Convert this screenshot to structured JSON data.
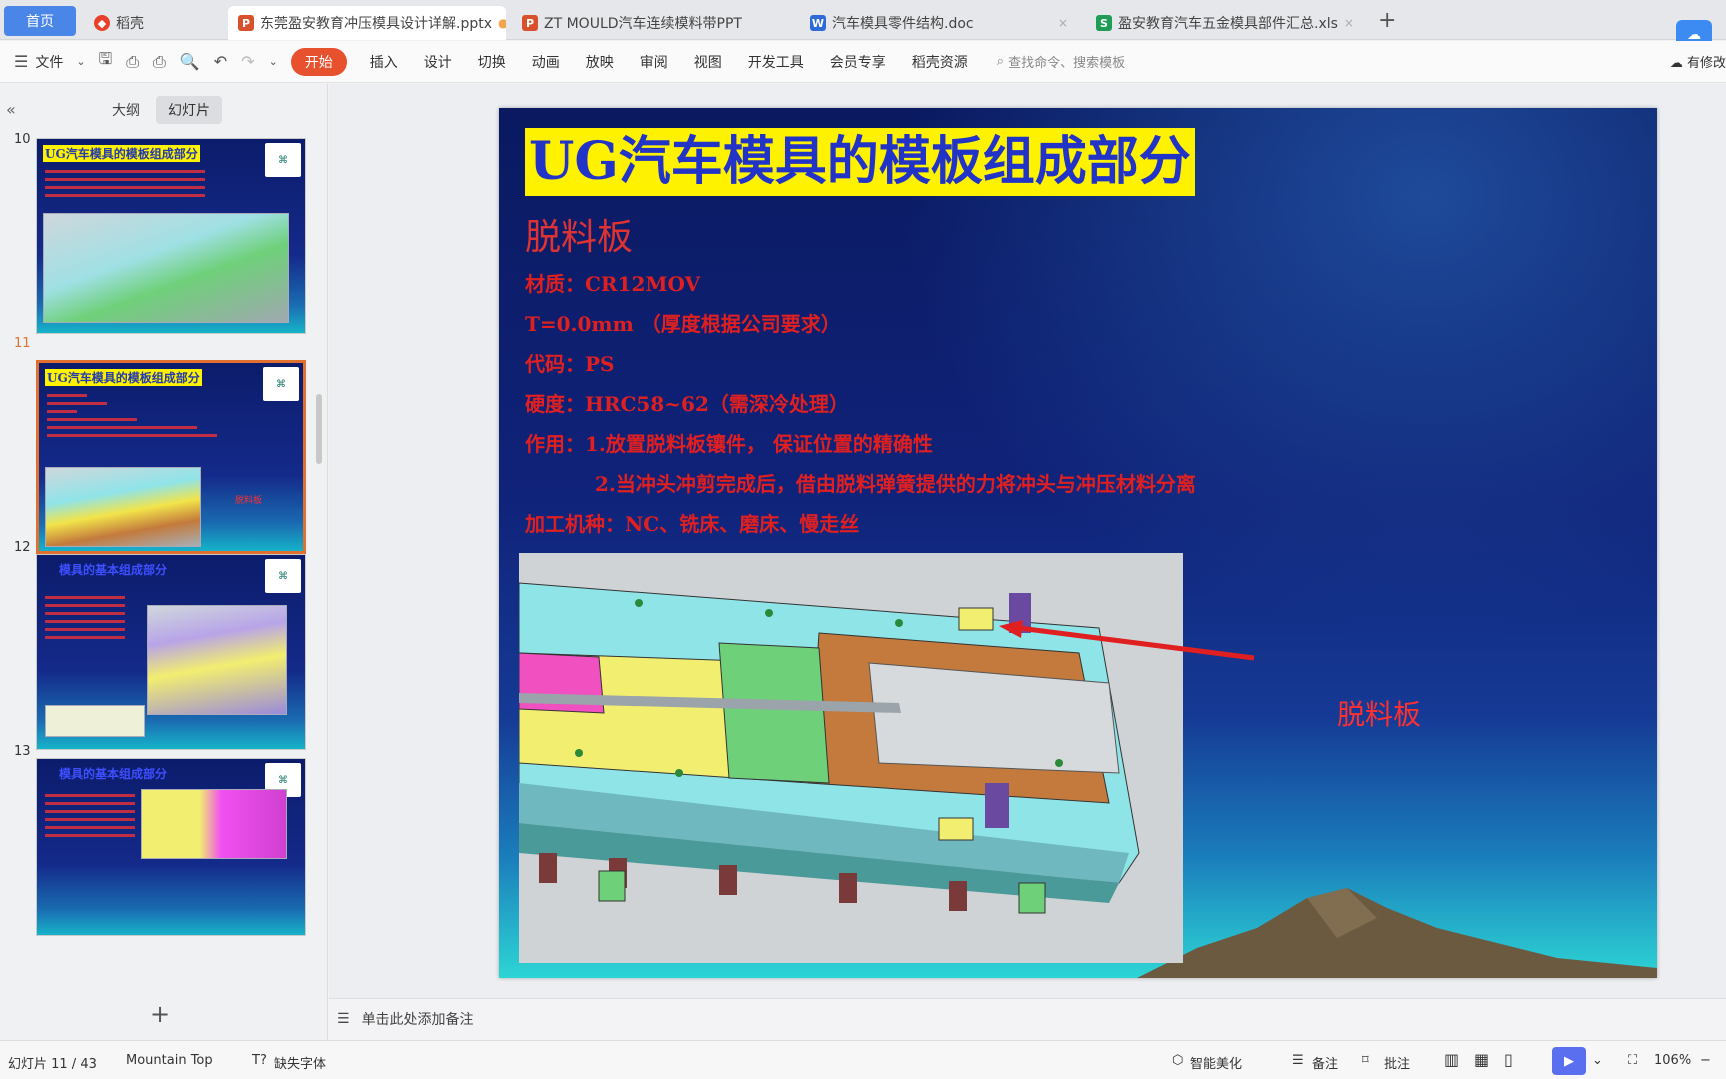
{
  "tabs": [
    {
      "label": "首页",
      "type": "home"
    },
    {
      "label": "稻壳",
      "icon": "docer"
    },
    {
      "label": "东莞盈安教育冲压模具设计详解.pptx",
      "icon": "ppt",
      "active": true
    },
    {
      "label": "ZT MOULD汽车连续模料带PPT",
      "icon": "ppt"
    },
    {
      "label": "汽车模具零件结构.doc",
      "icon": "doc"
    },
    {
      "label": "盈安教育汽车五金模具部件汇总.xls",
      "icon": "xls"
    }
  ],
  "toolbar": {
    "file": "文件",
    "start": "开始",
    "menus": [
      "插入",
      "设计",
      "切换",
      "动画",
      "放映",
      "审阅",
      "视图",
      "开发工具",
      "会员专享",
      "稻壳资源"
    ],
    "search_placeholder": "查找命令、搜索模板",
    "saved": "有修改"
  },
  "leftpane": {
    "outline": "大纲",
    "slides": "幻灯片"
  },
  "thumbs": [
    {
      "num": "10",
      "title": "UG汽车模具的模板组成部分"
    },
    {
      "num": "11",
      "title": "UG汽车模具的模板组成部分",
      "label": "脱料板"
    },
    {
      "num": "12",
      "title": "模具的基本组成部分"
    },
    {
      "num": "13",
      "title": "模具的基本组成部分"
    }
  ],
  "slide": {
    "title": "UG汽车模具的模板组成部分",
    "subtitle": "脱料板",
    "lines": [
      "材质：CR12MOV",
      "T=0.0mm （厚度根据公司要求）",
      "代码：PS",
      "硬度：HRC58~62（需深冷处理）",
      "作用：1.放置脱料板镶件， 保证位置的精确性",
      "2.当冲头冲剪完成后，借由脱料弹簧提供的力将冲头与冲压材料分离",
      "加工机种：NC、铣床、磨床、慢走丝"
    ],
    "callout": "脱料板"
  },
  "notes": "单击此处添加备注",
  "status": {
    "slide_count": "幻灯片 11 / 43",
    "theme": "Mountain Top",
    "missing_font": "缺失字体",
    "beautify": "智能美化",
    "notes_btn": "备注",
    "comment_btn": "批注",
    "zoom": "106%"
  }
}
